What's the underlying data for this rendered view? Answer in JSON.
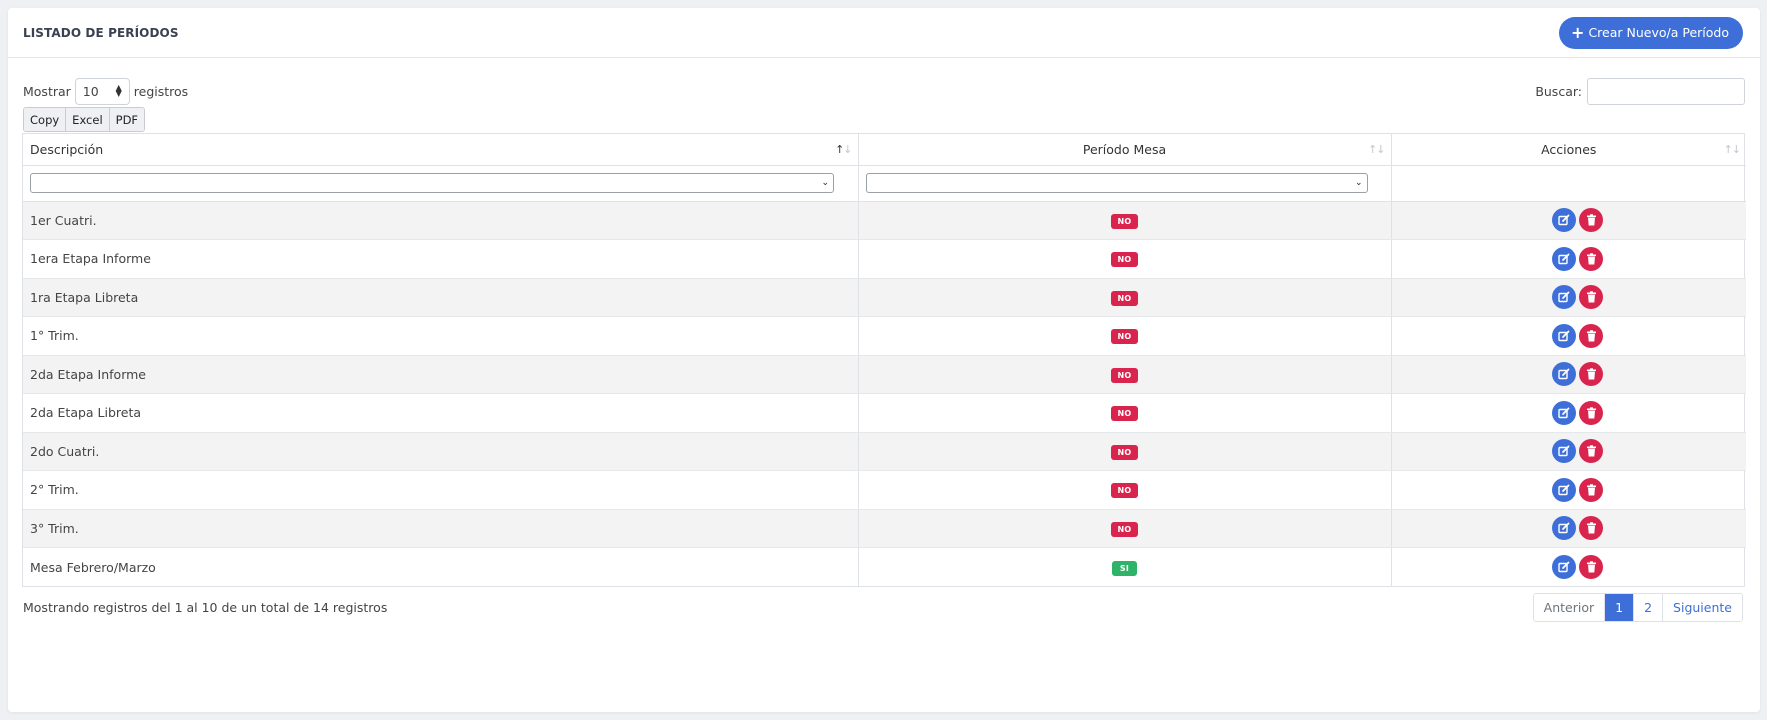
{
  "header": {
    "title": "LISTADO DE PERÍODOS",
    "create_label": "Crear Nuevo/a Período",
    "create_icon": "plus-icon"
  },
  "controls": {
    "show_label": "Mostrar",
    "page_size": "10",
    "records_label": "registros",
    "search_label": "Buscar:",
    "search_value": "",
    "export_buttons": [
      "Copy",
      "Excel",
      "PDF"
    ]
  },
  "table": {
    "columns": [
      "Descripción",
      "Período Mesa",
      "Acciones"
    ],
    "rows": [
      {
        "descripcion": "1er Cuatri.",
        "mesa": "NO"
      },
      {
        "descripcion": "1era Etapa Informe",
        "mesa": "NO"
      },
      {
        "descripcion": "1ra Etapa Libreta",
        "mesa": "NO"
      },
      {
        "descripcion": "1° Trim.",
        "mesa": "NO"
      },
      {
        "descripcion": "2da Etapa Informe",
        "mesa": "NO"
      },
      {
        "descripcion": "2da Etapa Libreta",
        "mesa": "NO"
      },
      {
        "descripcion": "2do Cuatri.",
        "mesa": "NO"
      },
      {
        "descripcion": "2° Trim.",
        "mesa": "NO"
      },
      {
        "descripcion": "3° Trim.",
        "mesa": "NO"
      },
      {
        "descripcion": "Mesa Febrero/Marzo",
        "mesa": "SI"
      }
    ]
  },
  "footer": {
    "info": "Mostrando registros del 1 al 10 de un total de 14 registros",
    "prev": "Anterior",
    "pages": [
      "1",
      "2"
    ],
    "current_page": "1",
    "next": "Siguiente"
  },
  "colors": {
    "primary": "#3e6fd8",
    "danger": "#d9244e",
    "success": "#2fb369"
  }
}
